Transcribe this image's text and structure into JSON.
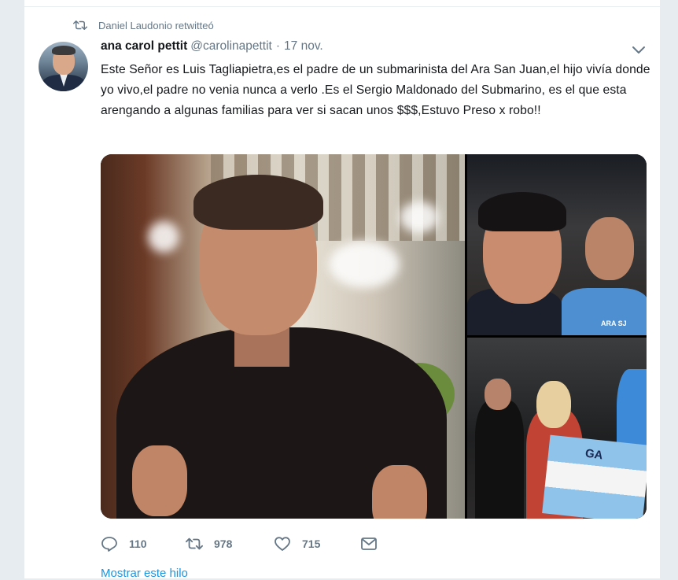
{
  "retweet_context": {
    "icon": "retweet-icon",
    "text": "Daniel Laudonio retwitteó"
  },
  "tweet": {
    "author_name": "ana carol pettit",
    "handle": "@carolinapettit",
    "separator": "·",
    "date": "17 nov.",
    "text": "Este Señor es Luis Tagliapietra,es el padre de un submarinista del Ara San Juan,el hijo vivía donde yo vivo,el padre no venia nunca a verlo .Es el Sergio Maldonado del Submarino, es el que esta arengando a algunas familias para ver si sacan unos $$$,Estuvo Preso x robo!!",
    "media": {
      "photo_3_banner_text": "GA",
      "photo_2_shirt_text": "ARA SJ"
    },
    "actions": {
      "reply_count": "110",
      "retweet_count": "978",
      "like_count": "715"
    },
    "show_thread_label": "Mostrar este hilo"
  },
  "colors": {
    "background": "#e6ecf0",
    "card": "#ffffff",
    "secondary_text": "#657786",
    "link": "#1b95e0"
  }
}
